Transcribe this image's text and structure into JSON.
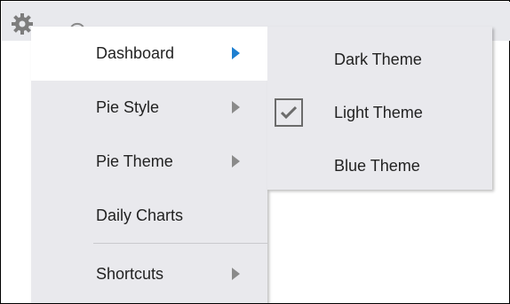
{
  "toolbar": {
    "settings_icon": "gear-icon",
    "secondary_icon": "circle-icon"
  },
  "menu": {
    "items": [
      {
        "label": "Dashboard",
        "has_submenu": true,
        "active": true
      },
      {
        "label": "Pie Style",
        "has_submenu": true,
        "active": false
      },
      {
        "label": "Pie Theme",
        "has_submenu": true,
        "active": false
      },
      {
        "label": "Daily Charts",
        "has_submenu": false,
        "active": false
      },
      {
        "label": "Shortcuts",
        "has_submenu": true,
        "active": false
      }
    ]
  },
  "submenu": {
    "items": [
      {
        "label": "Dark Theme",
        "checked": false
      },
      {
        "label": "Light Theme",
        "checked": true
      },
      {
        "label": "Blue Theme",
        "checked": false
      }
    ]
  },
  "colors": {
    "menu_background": "#e9e9ed",
    "active_item_background": "#ffffff",
    "active_arrow": "#1e7fd0",
    "inactive_arrow": "#8a8a8a"
  }
}
